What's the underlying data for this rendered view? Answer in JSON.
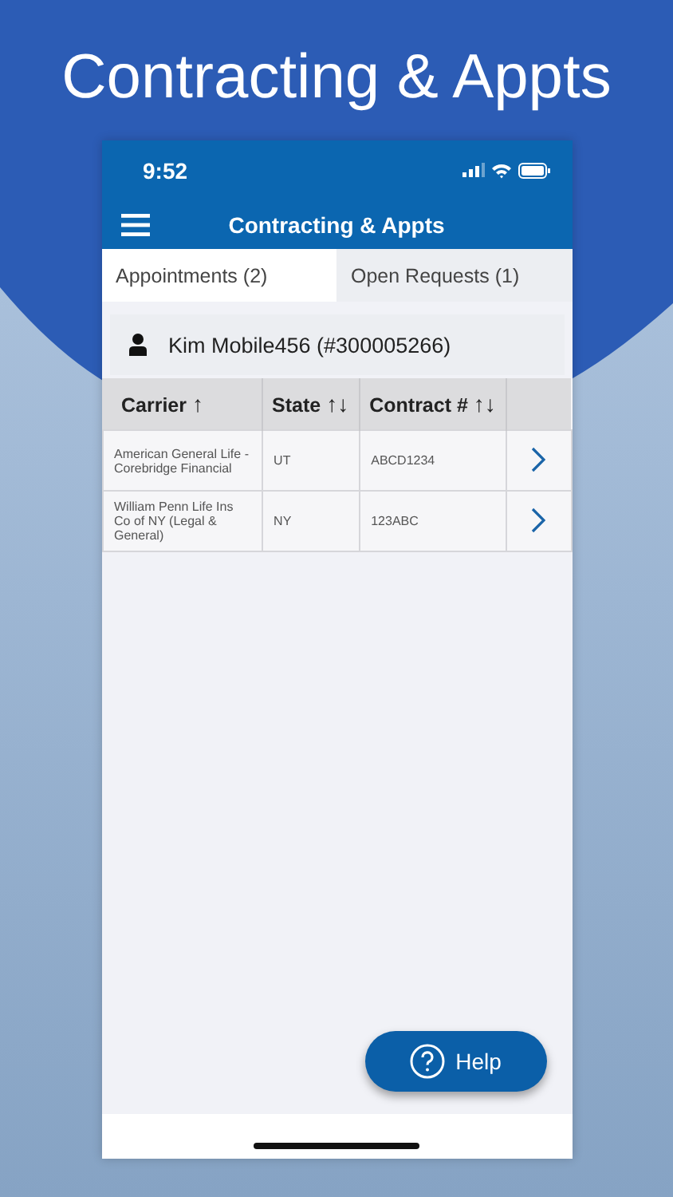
{
  "headline": "Contracting & Appts",
  "status_bar": {
    "time": "9:52"
  },
  "nav_bar": {
    "title": "Contracting & Appts"
  },
  "tabs": [
    {
      "label": "Appointments (2)",
      "selected": true
    },
    {
      "label": "Open Requests (1)",
      "selected": false
    }
  ],
  "agent": {
    "name": "Kim Mobile456 (#300005266)"
  },
  "table": {
    "columns": [
      {
        "label": "Carrier",
        "sort": "↑"
      },
      {
        "label": "State",
        "sort": "↑↓"
      },
      {
        "label": "Contract #",
        "sort": "↑↓"
      }
    ],
    "rows": [
      {
        "carrier": "American General Life - Corebridge Financial",
        "state": "UT",
        "contract": "ABCD1234"
      },
      {
        "carrier": "William Penn Life Ins Co of NY (Legal & General)",
        "state": "NY",
        "contract": "123ABC"
      }
    ]
  },
  "help_button": {
    "label": "Help"
  }
}
